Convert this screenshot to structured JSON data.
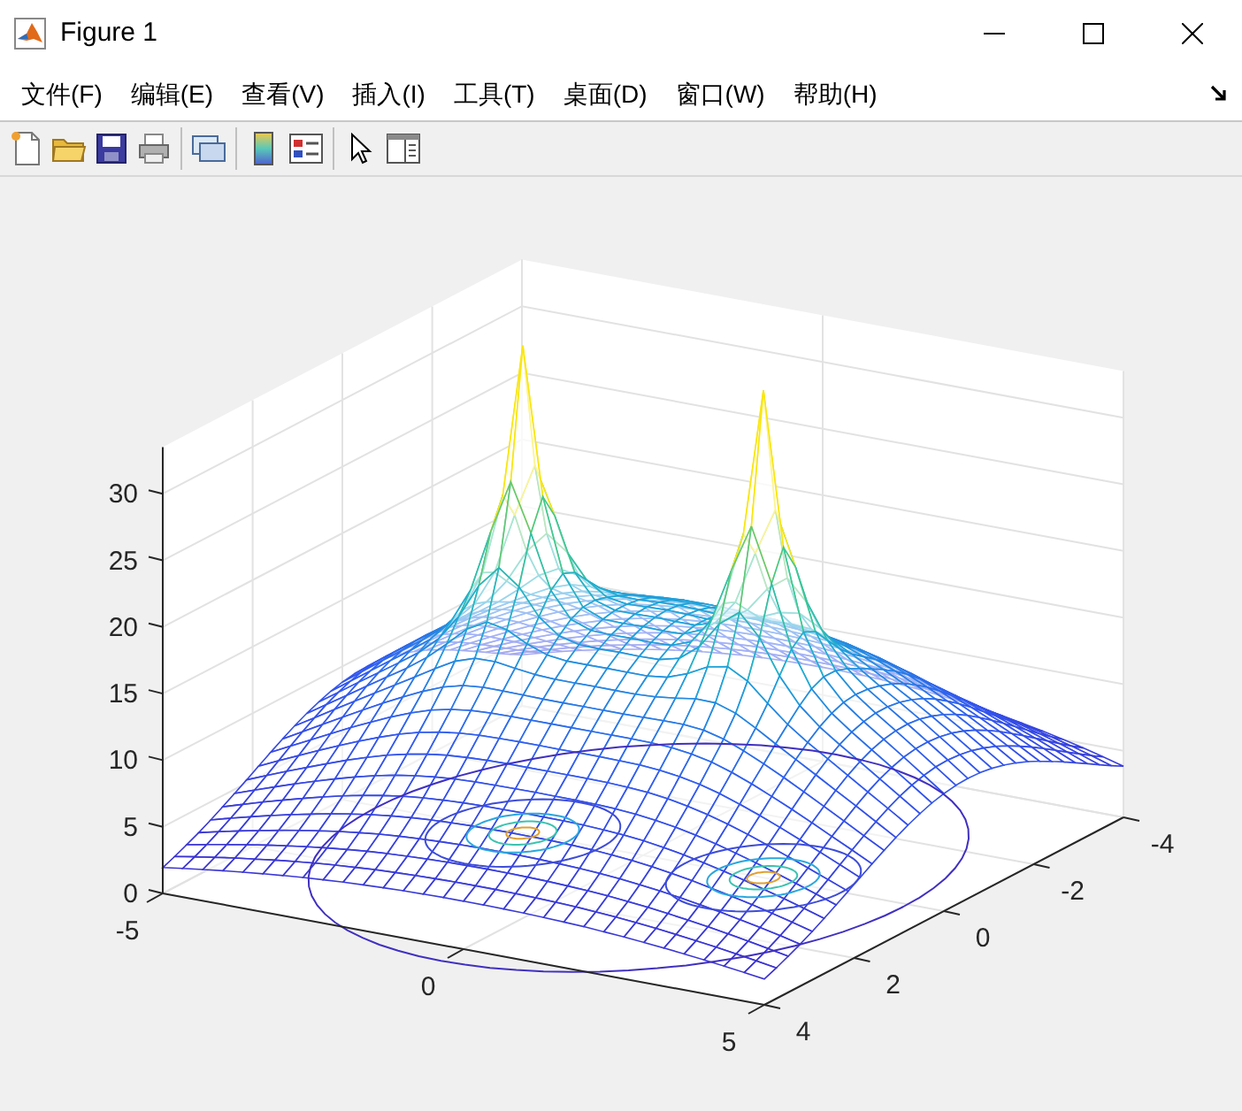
{
  "window": {
    "title": "Figure 1"
  },
  "menu": [
    "文件(F)",
    "编辑(E)",
    "查看(V)",
    "插入(I)",
    "工具(T)",
    "桌面(D)",
    "窗口(W)",
    "帮助(H)"
  ],
  "plot": {
    "z_ticks": [
      "30",
      "25",
      "20",
      "15",
      "10",
      "5",
      "0"
    ],
    "x_ticks": [
      "-5",
      "0",
      "5"
    ],
    "y_ticks": [
      "4",
      "2",
      "0",
      "-2",
      "-4"
    ]
  }
}
